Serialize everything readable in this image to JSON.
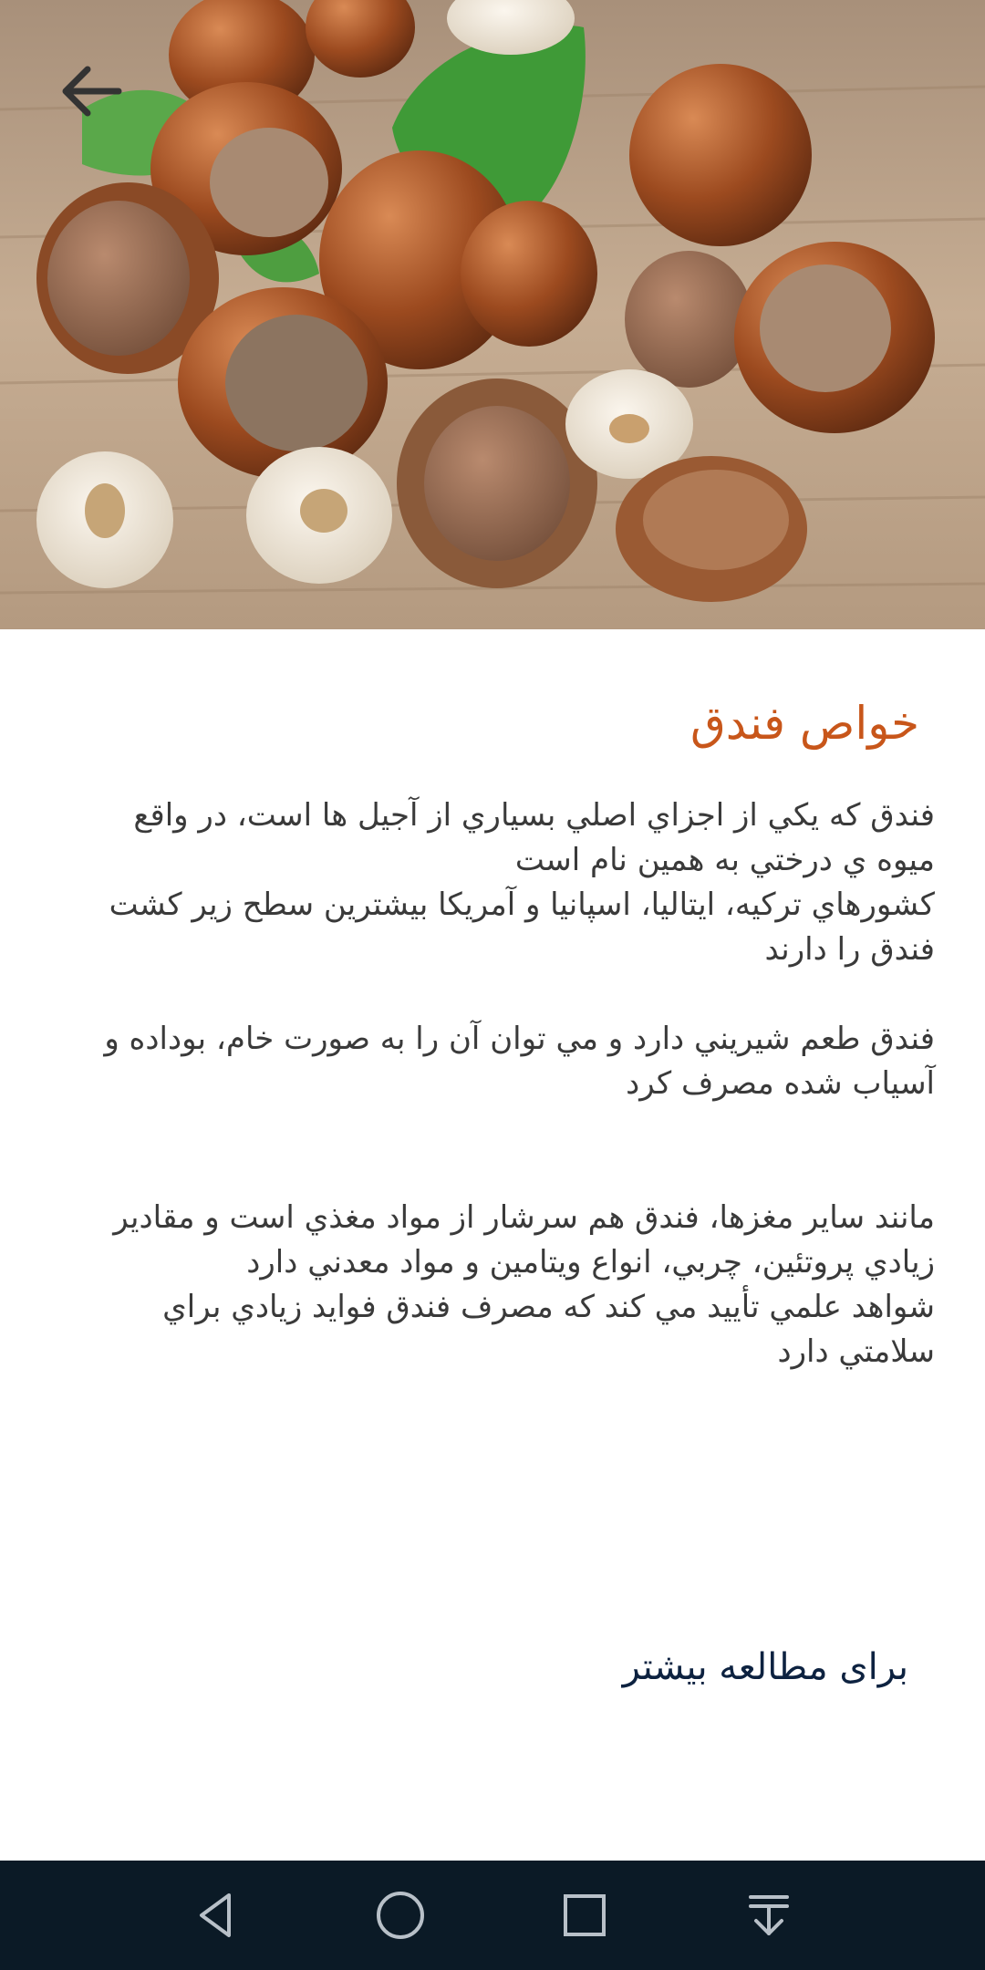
{
  "article": {
    "title": "خواص فندق",
    "paragraphs": [
      "فندق که يکي از اجزاي اصلي بسياري از آجيل ها است، در واقع\nميوه ي درختي به همين نام است\nکشورهاي ترکيه، ايتاليا، اسپانيا و آمريکا بيشترين سطح زير کشت\nفندق را دارند",
      "فندق طعم شيريني دارد و مي توان آن را به صورت خام، بوداده و\nآسياب شده مصرف کرد",
      "مانند ساير مغزها، فندق هم سرشار از مواد مغذي است و مقادير\nزيادي پروتئين، چربي، انواع ويتامين و مواد معدني دارد\nشواهد علمي تأييد مي کند که مصرف فندق فوايد زيادي براي\nسلامتي دارد"
    ],
    "read_more": "براى مطالعه بيشتر"
  },
  "icons": {
    "back": "arrow-left-icon",
    "nav_back": "triangle-back-icon",
    "nav_home": "circle-home-icon",
    "nav_recents": "square-recents-icon",
    "nav_notifications": "pull-down-icon"
  },
  "colors": {
    "title": "#c8561a",
    "link": "#0d2240",
    "navbar": "#0b1a26"
  }
}
